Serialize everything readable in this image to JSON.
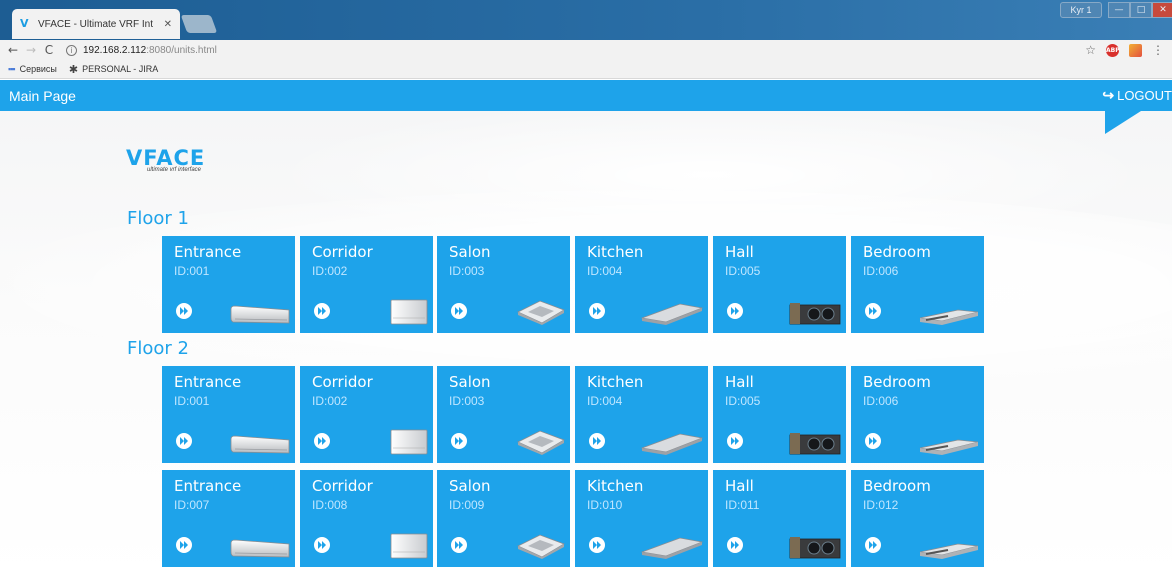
{
  "browser": {
    "tab_title": "VFACE - Ultimate VRF Int",
    "url_host": "192.168.2.112",
    "url_path": ":8080/units.html",
    "profile": "Kyr 1",
    "ext_label": "ABP",
    "bookmarks": [
      "Сервисы",
      "PERSONAL - JIRA"
    ]
  },
  "header": {
    "title": "Main Page",
    "logout": "LOGOUT",
    "color": "#1ea3ea"
  },
  "logo": {
    "text": "VFACE",
    "subtitle": "ultimate vrf interface"
  },
  "floors": [
    {
      "label": "Floor 1"
    },
    {
      "label": "Floor 2"
    }
  ],
  "units": {
    "row1": [
      {
        "name": "Entrance",
        "id": "ID:001",
        "icon": "wall-split-unit-icon"
      },
      {
        "name": "Corridor",
        "id": "ID:002",
        "icon": "console-unit-icon"
      },
      {
        "name": "Salon",
        "id": "ID:003",
        "icon": "cassette-unit-icon"
      },
      {
        "name": "Kitchen",
        "id": "ID:004",
        "icon": "ceiling-unit-icon"
      },
      {
        "name": "Hall",
        "id": "ID:005",
        "icon": "fan-coil-unit-icon"
      },
      {
        "name": "Bedroom",
        "id": "ID:006",
        "icon": "duct-unit-icon"
      }
    ],
    "row2": [
      {
        "name": "Entrance",
        "id": "ID:001",
        "icon": "wall-split-unit-icon"
      },
      {
        "name": "Corridor",
        "id": "ID:002",
        "icon": "console-unit-icon"
      },
      {
        "name": "Salon",
        "id": "ID:003",
        "icon": "cassette-unit-icon"
      },
      {
        "name": "Kitchen",
        "id": "ID:004",
        "icon": "ceiling-unit-icon"
      },
      {
        "name": "Hall",
        "id": "ID:005",
        "icon": "fan-coil-unit-icon"
      },
      {
        "name": "Bedroom",
        "id": "ID:006",
        "icon": "duct-unit-icon"
      }
    ],
    "row3": [
      {
        "name": "Entrance",
        "id": "ID:007",
        "icon": "wall-split-unit-icon"
      },
      {
        "name": "Corridor",
        "id": "ID:008",
        "icon": "console-unit-icon"
      },
      {
        "name": "Salon",
        "id": "ID:009",
        "icon": "cassette-unit-icon"
      },
      {
        "name": "Kitchen",
        "id": "ID:010",
        "icon": "ceiling-unit-icon"
      },
      {
        "name": "Hall",
        "id": "ID:011",
        "icon": "fan-coil-unit-icon"
      },
      {
        "name": "Bedroom",
        "id": "ID:012",
        "icon": "duct-unit-icon"
      }
    ]
  }
}
